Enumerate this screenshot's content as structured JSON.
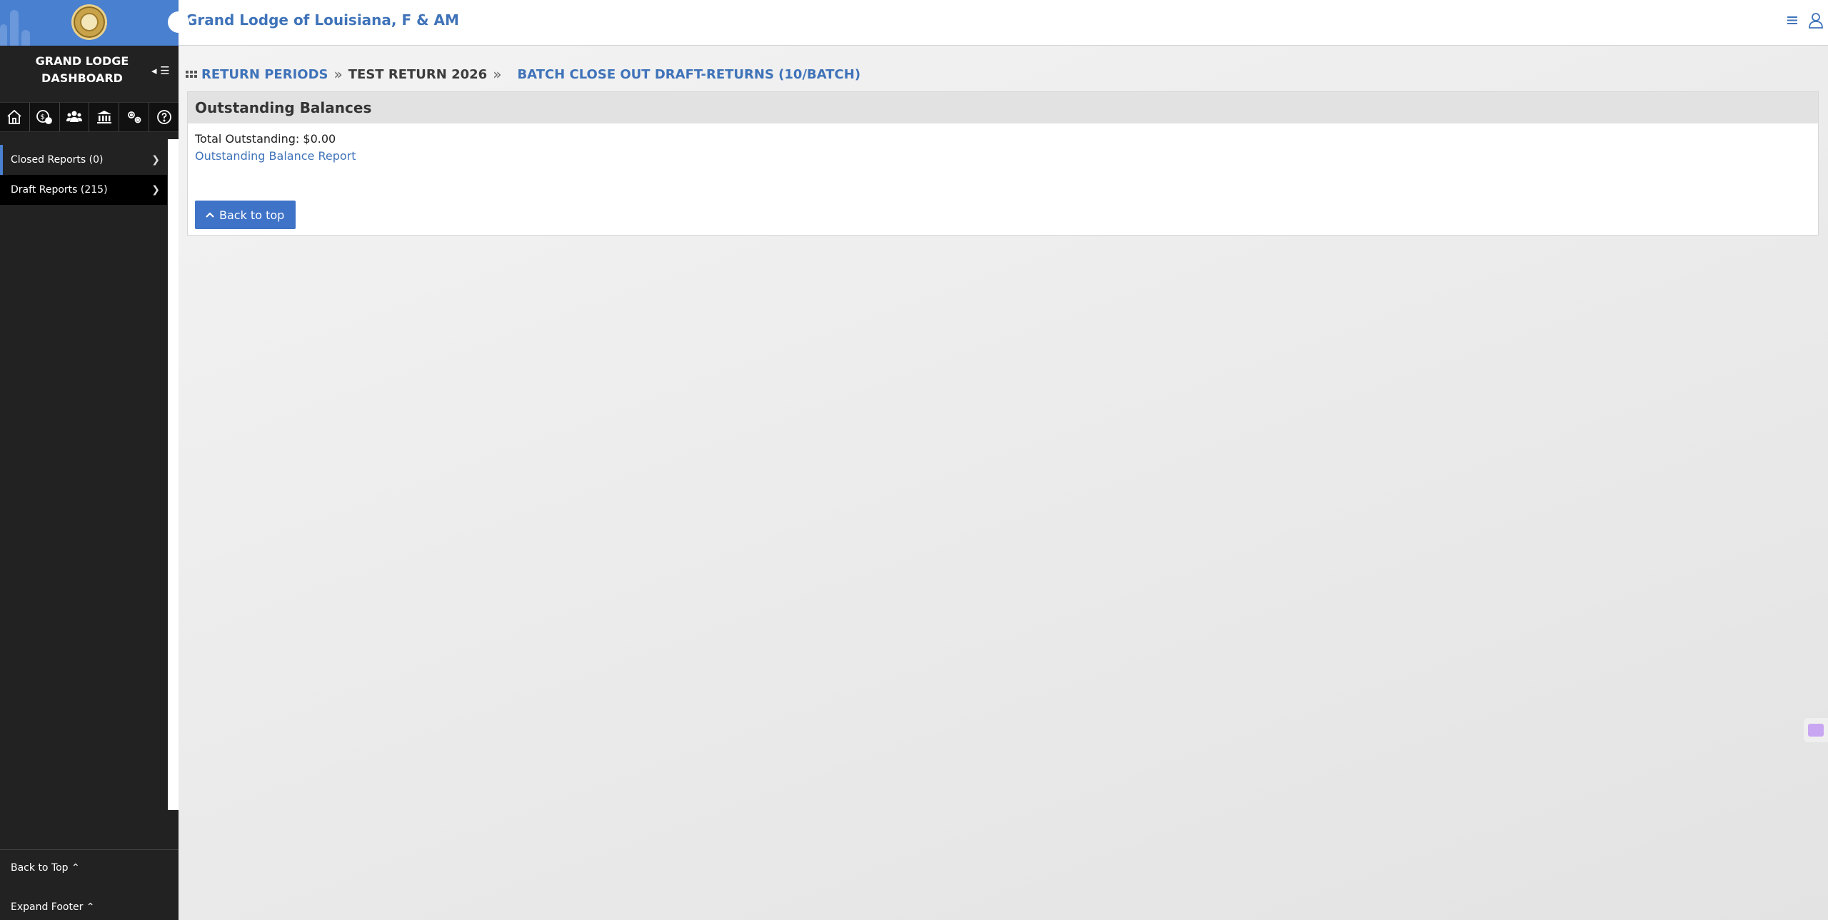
{
  "header": {
    "org_name": "Grand Lodge of Louisiana, F & AM",
    "menu_icon": "hamburger-icon",
    "user_icon": "user-icon"
  },
  "sidebar": {
    "title": "GRAND LODGE DASHBOARD",
    "collapse_label": "◂ ☰",
    "icons": [
      "home-icon",
      "money-icon",
      "members-icon",
      "bank-icon",
      "settings-icon",
      "help-icon"
    ],
    "items": [
      {
        "label": "Closed Reports (0)"
      },
      {
        "label": "Draft Reports (215)"
      }
    ],
    "footer": {
      "back_to_top": "Back to Top ⌃",
      "expand_footer": "Expand Footer ⌃"
    }
  },
  "breadcrumb": {
    "items": [
      {
        "label": "RETURN PERIODS"
      },
      {
        "label": "TEST RETURN 2026"
      },
      {
        "label": "BATCH CLOSE OUT DRAFT-RETURNS (10/BATCH)"
      }
    ]
  },
  "panel": {
    "title": "Outstanding Balances",
    "total_text": "Total Outstanding: $0.00",
    "report_link": "Outstanding Balance Report",
    "back_button": "Back to top"
  },
  "colors": {
    "accent": "#3f73b9",
    "sidebar_bg": "#222222",
    "header_blue": "#4a80d0",
    "button_blue": "#3f73c8"
  }
}
